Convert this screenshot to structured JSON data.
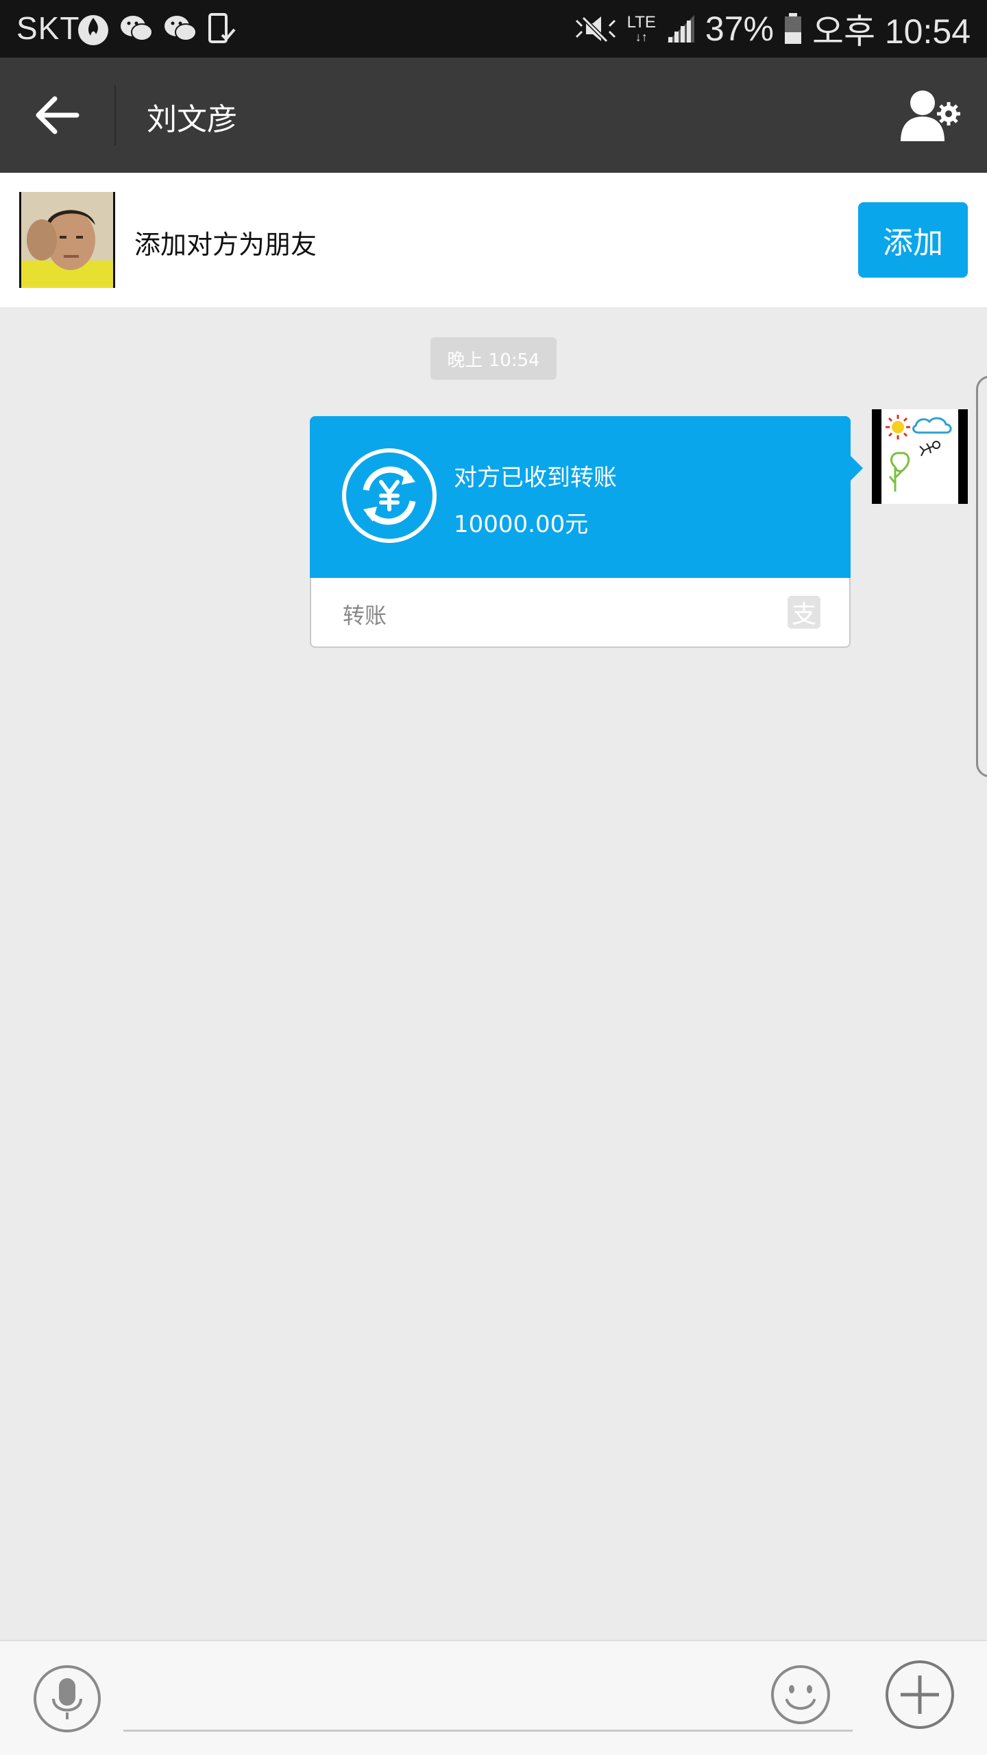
{
  "status_bar": {
    "carrier": "SKT",
    "lte": "LTE",
    "battery": "37%",
    "time": "오후 10:54"
  },
  "header": {
    "title": "刘文彦"
  },
  "add_friend": {
    "text": "添加对方为朋友",
    "button_label": "添加"
  },
  "chat": {
    "timestamp": "晚上 10:54",
    "transfer": {
      "status": "对方已收到转账",
      "amount": "10000.00元",
      "label": "转账",
      "alipay_glyph": "支"
    }
  },
  "colors": {
    "accent": "#0aa6ec",
    "title_bar": "#3a3a3a",
    "background": "#ebebeb"
  }
}
